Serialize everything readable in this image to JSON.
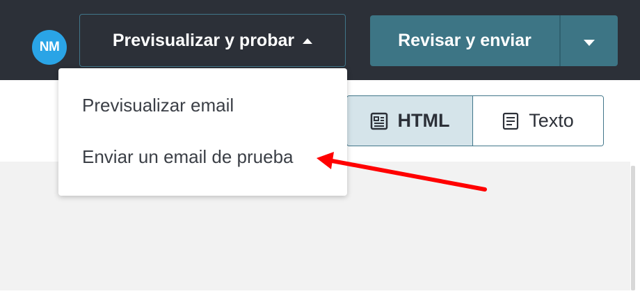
{
  "header": {
    "avatar_initials": "NM",
    "preview_menu_button": "Previsualizar y probar",
    "review_send_button": "Revisar y enviar"
  },
  "preview_menu": {
    "items": [
      {
        "label": "Previsualizar email"
      },
      {
        "label": "Enviar un email de prueba"
      }
    ]
  },
  "view_toggle": {
    "html_label": "HTML",
    "text_label": "Texto",
    "selected": "HTML"
  },
  "colors": {
    "topbar_bg": "#2c3038",
    "accent": "#3d7585",
    "avatar_bg": "#2aa4e6",
    "selected_toggle_bg": "#d5e4ea",
    "annotation_arrow": "#ff0000"
  },
  "icons": {
    "caret_up": "caret-up-icon",
    "caret_down": "caret-down-icon",
    "html_view": "html-view-icon",
    "text_view": "text-view-icon"
  }
}
